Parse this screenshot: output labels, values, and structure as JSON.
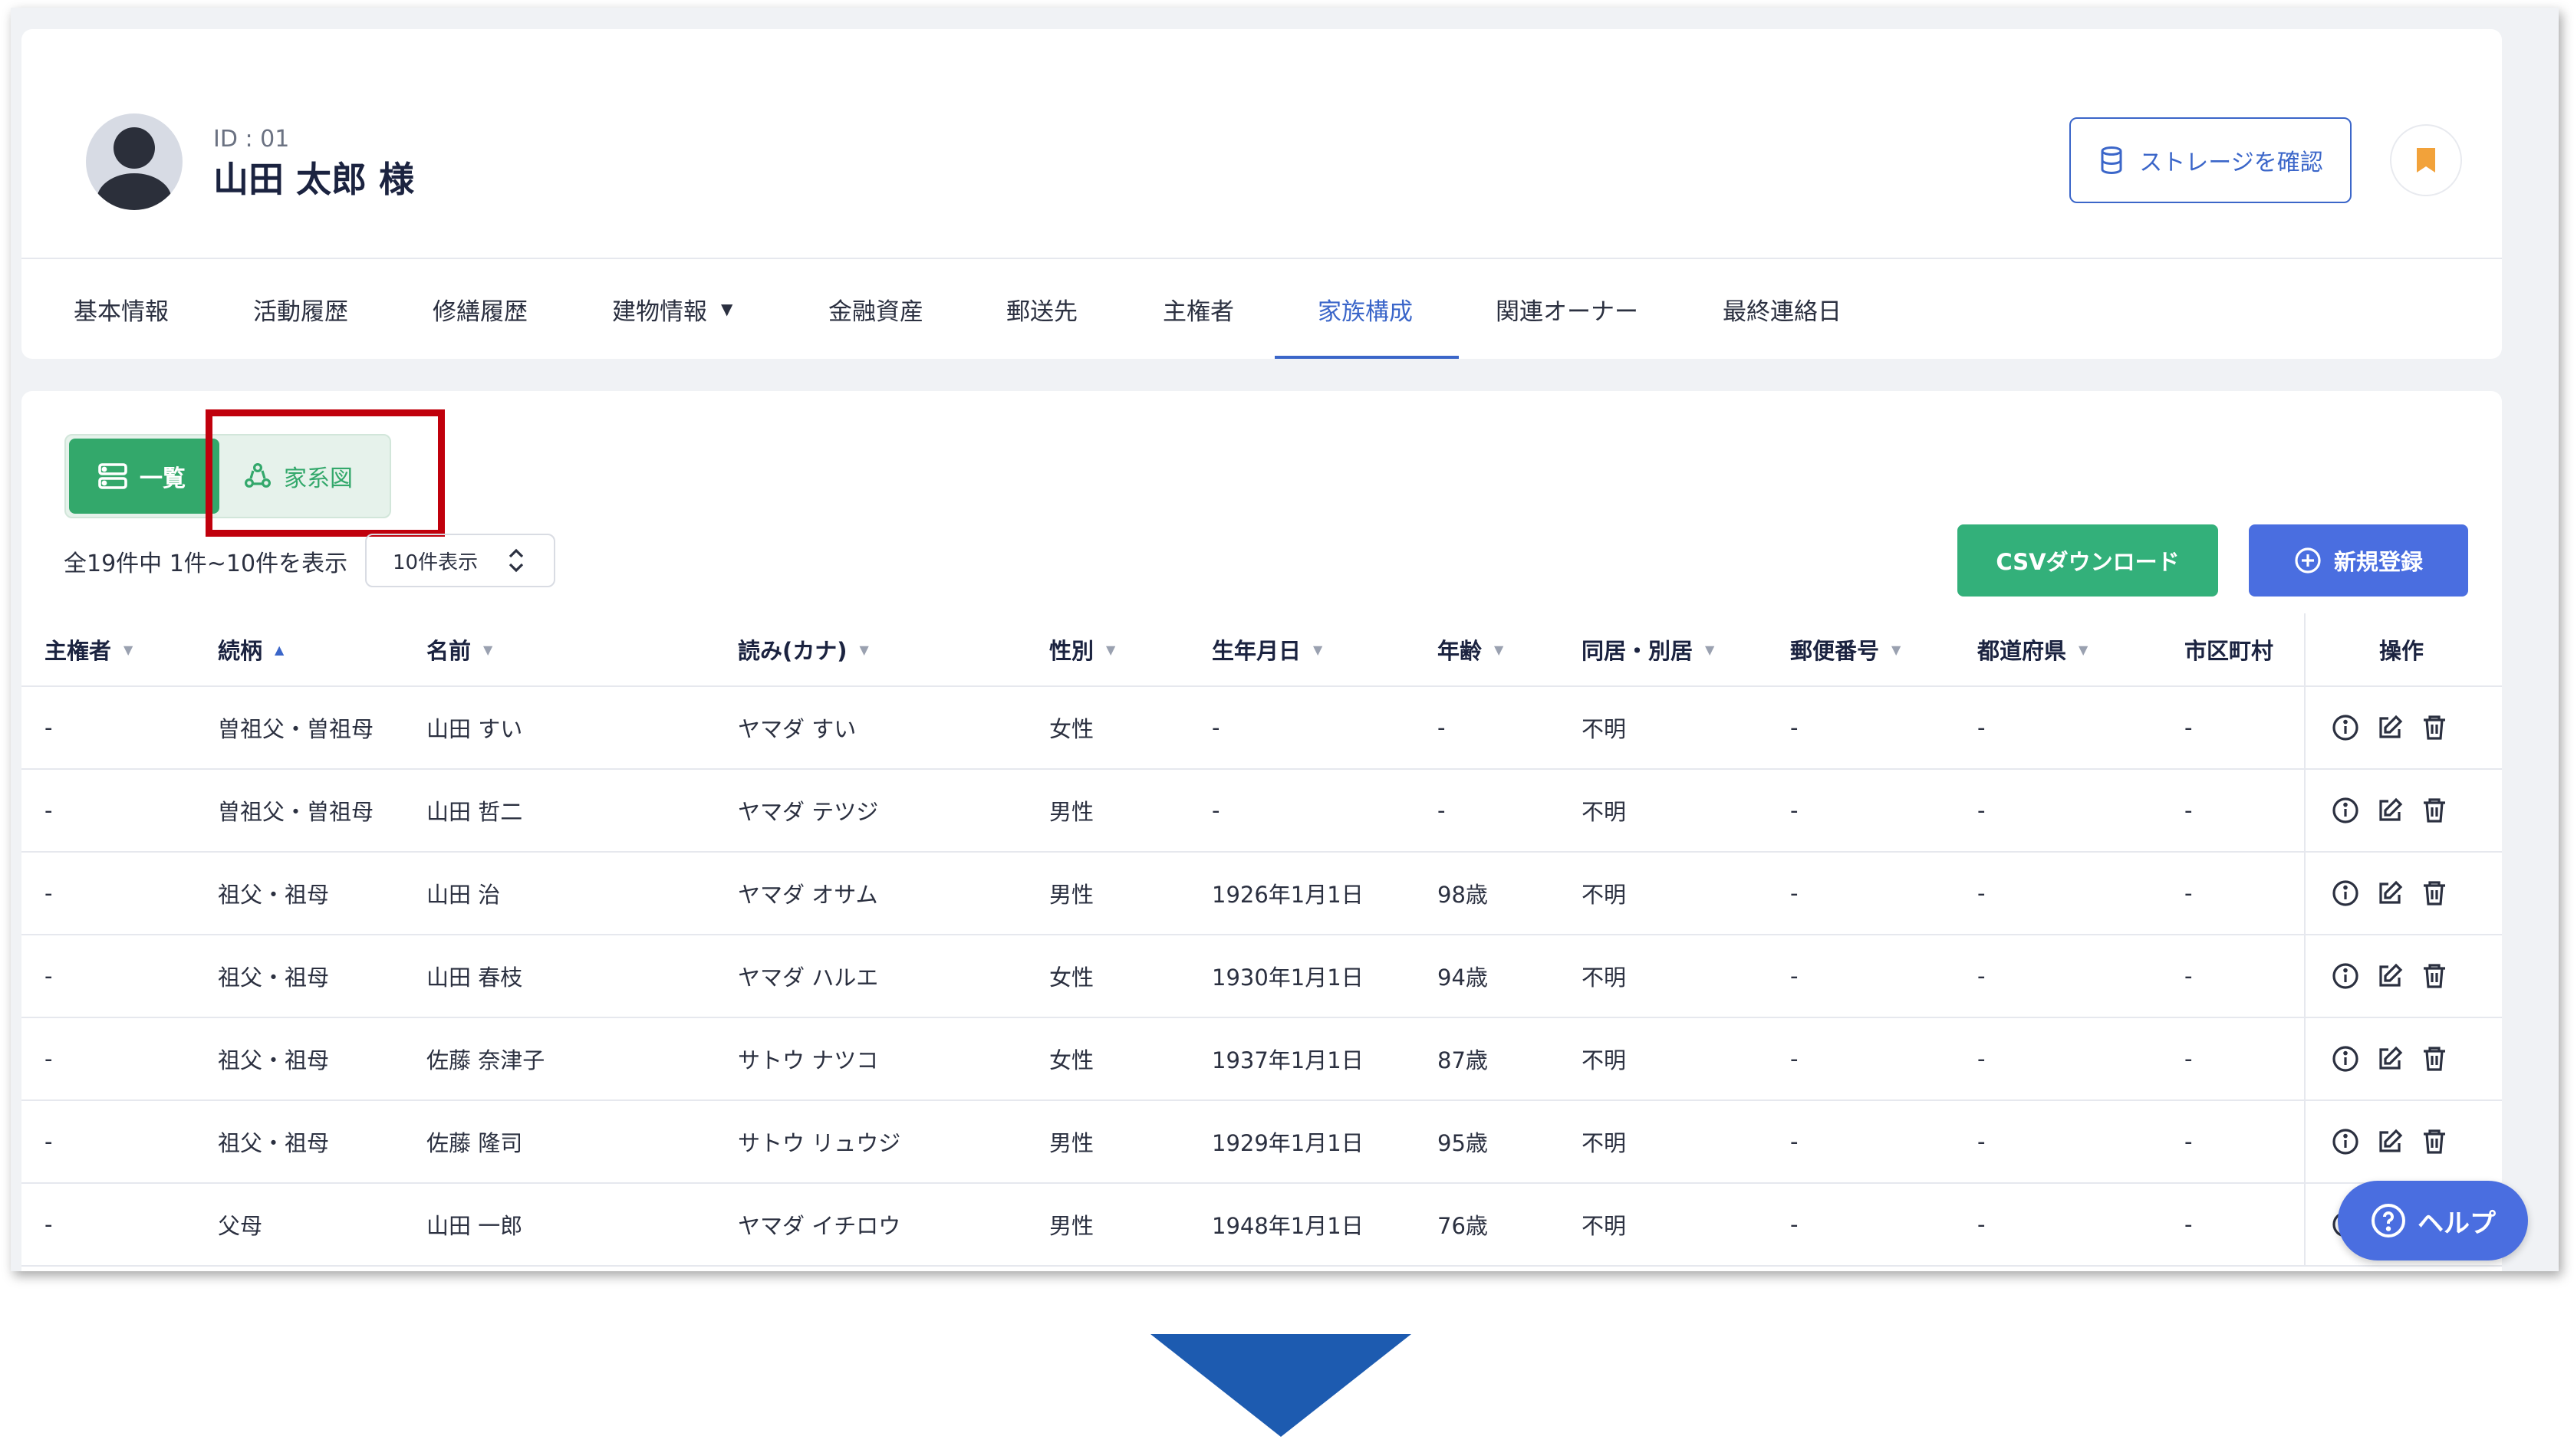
{
  "customer": {
    "id": "ID : 01",
    "name": "山田 太郎 様"
  },
  "header": {
    "storage_button": "ストレージを確認"
  },
  "tabs": [
    {
      "label": "基本情報"
    },
    {
      "label": "活動履歴"
    },
    {
      "label": "修繕履歴"
    },
    {
      "label": "建物情報"
    },
    {
      "label": "金融資産"
    },
    {
      "label": "郵送先"
    },
    {
      "label": "主権者"
    },
    {
      "label": "家族構成"
    },
    {
      "label": "関連オーナー"
    },
    {
      "label": "最終連絡日"
    }
  ],
  "active_tab": "家族構成",
  "view_toggle": {
    "list": "一覧",
    "tree": "家系図"
  },
  "summary": "全19件中 1件~10件を表示",
  "page_size": "10件表示",
  "actions": {
    "csv": "CSVダウンロード",
    "new": "新規登録"
  },
  "table": {
    "columns": [
      "主権者",
      "続柄",
      "名前",
      "読み(カナ)",
      "性別",
      "生年月日",
      "年齢",
      "同居・別居",
      "郵便番号",
      "都道府県",
      "市区町村",
      "操作"
    ],
    "rows": [
      [
        "-",
        "曽祖父・曽祖母",
        "山田 すい",
        "ヤマダ すい",
        "女性",
        "-",
        "-",
        "不明",
        "-",
        "-",
        "-"
      ],
      [
        "-",
        "曽祖父・曽祖母",
        "山田 哲二",
        "ヤマダ テツジ",
        "男性",
        "-",
        "-",
        "不明",
        "-",
        "-",
        "-"
      ],
      [
        "-",
        "祖父・祖母",
        "山田 治",
        "ヤマダ オサム",
        "男性",
        "1926年1月1日",
        "98歳",
        "不明",
        "-",
        "-",
        "-"
      ],
      [
        "-",
        "祖父・祖母",
        "山田 春枝",
        "ヤマダ ハルエ",
        "女性",
        "1930年1月1日",
        "94歳",
        "不明",
        "-",
        "-",
        "-"
      ],
      [
        "-",
        "祖父・祖母",
        "佐藤 奈津子",
        "サトウ ナツコ",
        "女性",
        "1937年1月1日",
        "87歳",
        "不明",
        "-",
        "-",
        "-"
      ],
      [
        "-",
        "祖父・祖母",
        "佐藤 隆司",
        "サトウ リュウジ",
        "男性",
        "1929年1月1日",
        "95歳",
        "不明",
        "-",
        "-",
        "-"
      ],
      [
        "-",
        "父母",
        "山田 一郎",
        "ヤマダ イチロウ",
        "男性",
        "1948年1月1日",
        "76歳",
        "不明",
        "-",
        "-",
        "-"
      ]
    ]
  },
  "help": "ヘルプ",
  "colors": {
    "primary": "#3b66c9",
    "green": "#33a86b",
    "highlight": "#c0000c",
    "arrow": "#1d5bb0"
  }
}
